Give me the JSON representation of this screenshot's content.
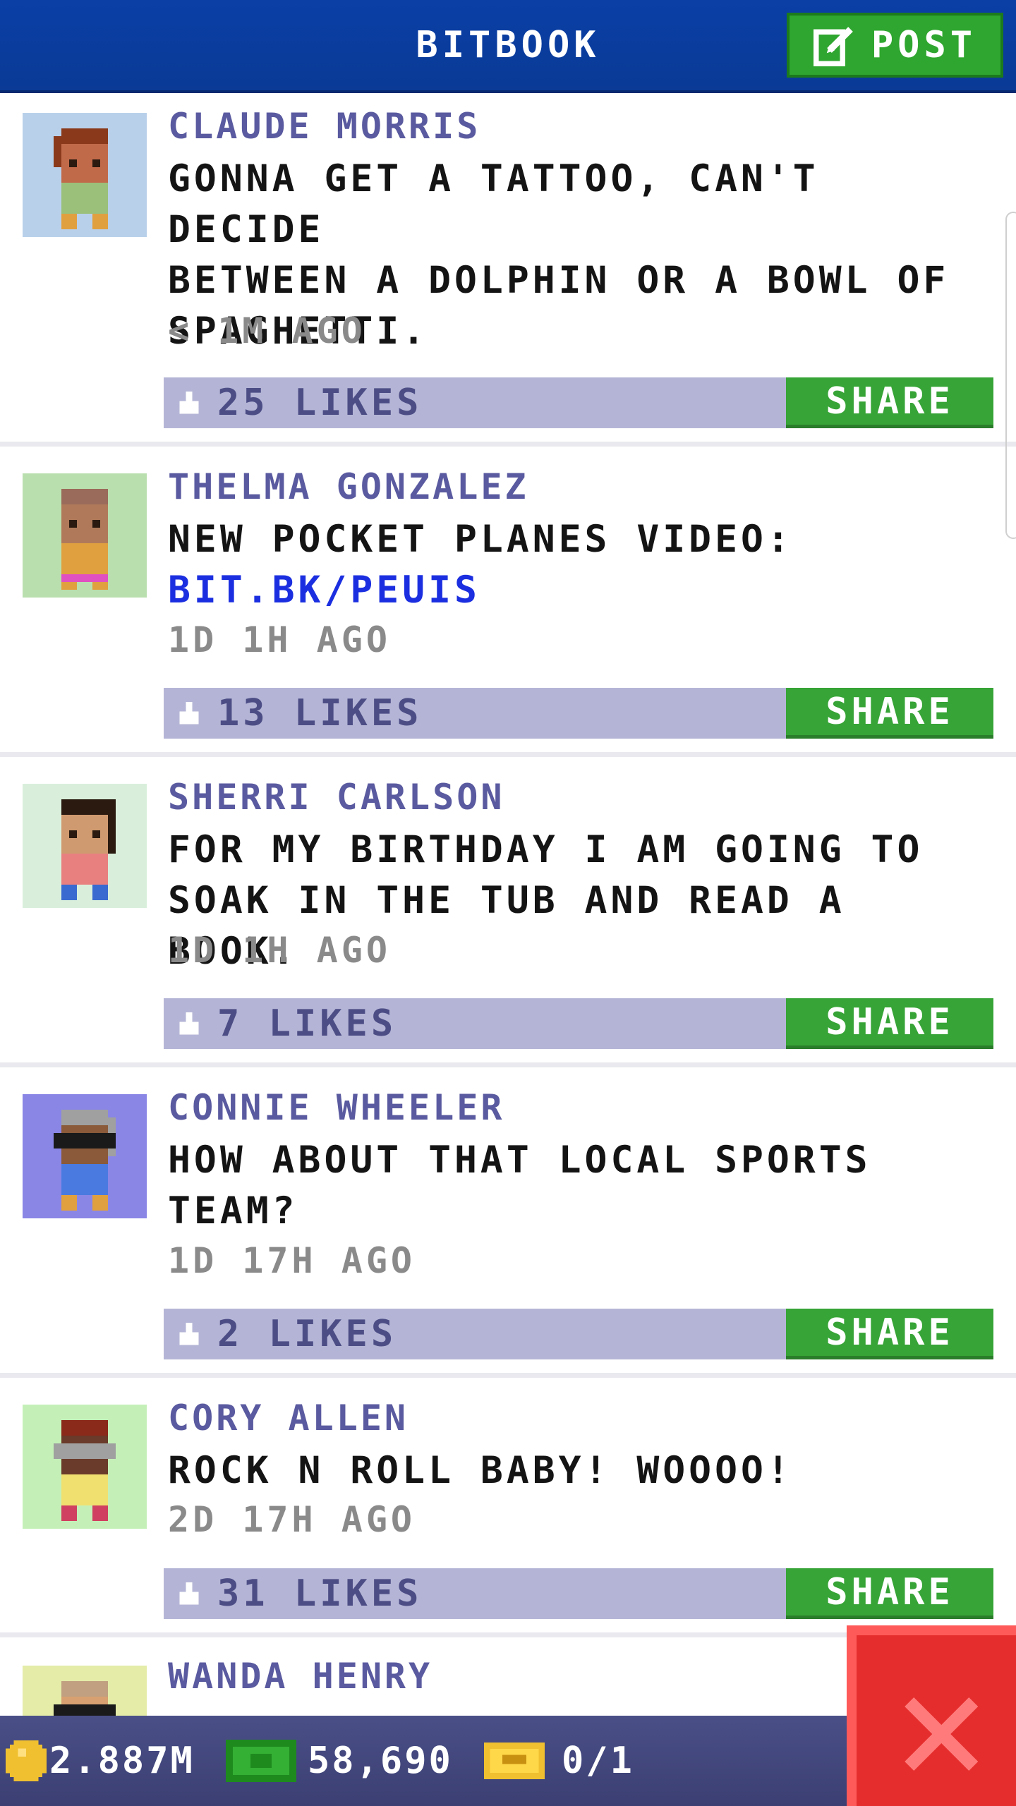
{
  "header": {
    "title": "BITBOOK",
    "post_label": "POST"
  },
  "posts": [
    {
      "name": "CLAUDE MORRIS",
      "lines": [
        "GONNA GET A TATTOO, CAN'T DECIDE",
        "BETWEEN A DOLPHIN OR A BOWL OF",
        "SPAGHETTI."
      ],
      "time": "< 1M AGO",
      "likes": "25 LIKES",
      "share": "SHARE"
    },
    {
      "name": "THELMA GONZALEZ",
      "lines": [
        "NEW POCKET PLANES VIDEO:"
      ],
      "link": "BIT.BK/PEUIS",
      "time": "1D 1H AGO",
      "likes": "13 LIKES",
      "share": "SHARE"
    },
    {
      "name": "SHERRI CARLSON",
      "lines": [
        "FOR MY BIRTHDAY I AM GOING TO",
        "SOAK IN THE TUB AND READ A BOOK."
      ],
      "time": "1D 1H AGO",
      "likes": "7 LIKES",
      "share": "SHARE"
    },
    {
      "name": "CONNIE WHEELER",
      "lines": [
        "HOW ABOUT THAT LOCAL SPORTS",
        "TEAM?"
      ],
      "time": "1D 17H AGO",
      "likes": "2 LIKES",
      "share": "SHARE"
    },
    {
      "name": "CORY ALLEN",
      "lines": [
        "ROCK N ROLL BABY! WOOOO!"
      ],
      "time": "2D 17H AGO",
      "likes": "31 LIKES",
      "share": "SHARE"
    },
    {
      "name": "WANDA HENRY"
    }
  ],
  "footer": {
    "coins": "2.887M",
    "bux": "58,690",
    "tickets": "0/1"
  },
  "colors": {
    "header": "#0b3fa6",
    "share": "#36a436",
    "likes_bar": "#b4b5d6",
    "name": "#5a5aa0",
    "link": "#1b2fe0",
    "close": "#e62d2d"
  },
  "icons": {
    "post": "edit-icon",
    "like": "thumbs-up-icon",
    "coin": "coin-icon",
    "bux": "bux-icon",
    "ticket": "ticket-icon",
    "close": "close-icon"
  }
}
